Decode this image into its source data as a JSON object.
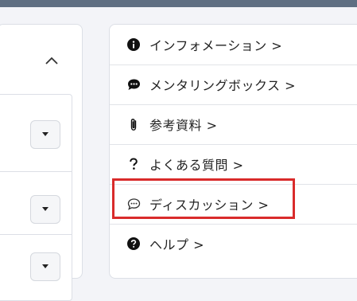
{
  "menu": {
    "items": [
      {
        "label": "インフォメーション >",
        "icon": "info-icon"
      },
      {
        "label": "メンタリングボックス >",
        "icon": "chat-bubble-icon"
      },
      {
        "label": "参考資料 >",
        "icon": "paperclip-icon"
      },
      {
        "label": "よくある質問 >",
        "icon": "question-mark-icon"
      },
      {
        "label": "ディスカッション >",
        "icon": "discussion-icon"
      },
      {
        "label": "ヘルプ >",
        "icon": "help-circle-icon"
      }
    ],
    "highlighted_item": "ディスカッション >"
  },
  "left_panel": {
    "collapse_icon": "chevron-up-icon",
    "dropdown_icon": "caret-down-icon"
  },
  "colors": {
    "highlight": "#d92b2b",
    "topbar": "#5f6f82",
    "background": "#f3f4f8"
  }
}
